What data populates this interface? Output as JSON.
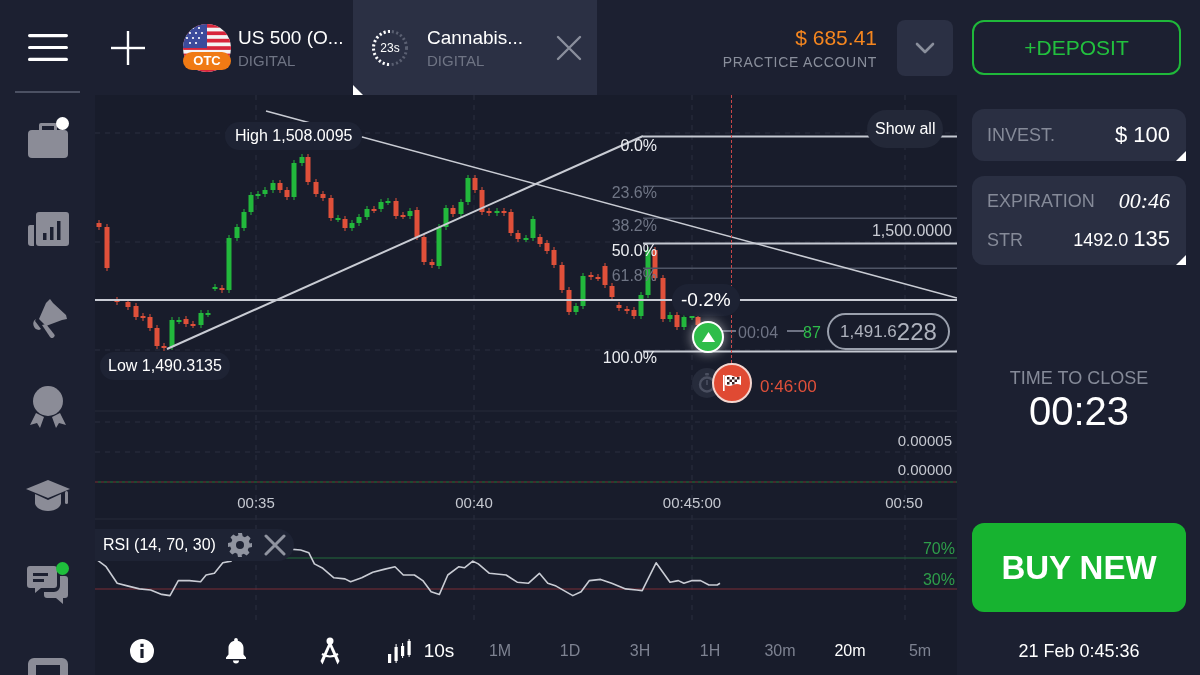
{
  "top_bar": {
    "assets": [
      {
        "kind": "flag",
        "name": "US 500 (O...",
        "type": "DIGITAL",
        "badge": "OTC",
        "selected": false
      },
      {
        "kind": "timer",
        "name": "Cannabis...",
        "type": "DIGITAL",
        "timer": "23s",
        "selected": true
      }
    ],
    "balance": "$ 685.41",
    "account": "PRACTICE ACCOUNT"
  },
  "sidebar": {
    "items": [
      {
        "notification": true,
        "color": "#ffffff"
      },
      {
        "notification": false
      },
      {
        "notification": false
      },
      {
        "notification": false
      },
      {
        "notification": false
      },
      {
        "notification": true,
        "color": "#1fbf3c"
      },
      {
        "notification": false
      }
    ]
  },
  "chart": {
    "high_label": "High 1,508.0095",
    "low_label": "Low 1,490.3135",
    "fib_levels": [
      {
        "label": "0.0%",
        "highlighted": true
      },
      {
        "label": "23.6%",
        "highlighted": false
      },
      {
        "label": "38.2%",
        "highlighted": false
      },
      {
        "label": "50.0%",
        "highlighted": true
      },
      {
        "label": "61.8%",
        "highlighted": false
      },
      {
        "label": "100.0%",
        "highlighted": true
      }
    ],
    "show_all": "Show all",
    "price_level": "1,500.0000",
    "change": "-0.2%",
    "trade": {
      "kind": "up",
      "countdown": "00:04",
      "payout": "87"
    },
    "current_price": {
      "main": "1,491.6",
      "tail": "228"
    },
    "expiry": "0:46:00",
    "scale_labels": [
      "0.00005",
      "0.00000"
    ],
    "time_axis": [
      "00:35",
      "00:40",
      "00:45:00",
      "00:50"
    ]
  },
  "rsi": {
    "label": "RSI (14, 70, 30)",
    "levels": [
      "70%",
      "30%"
    ]
  },
  "toolbar": {
    "interval": "10s",
    "periods": [
      {
        "label": "1M",
        "selected": false
      },
      {
        "label": "1D",
        "selected": false
      },
      {
        "label": "3H",
        "selected": false
      },
      {
        "label": "1H",
        "selected": false
      },
      {
        "label": "30m",
        "selected": false
      },
      {
        "label": "20m",
        "selected": true
      },
      {
        "label": "5m",
        "selected": false
      }
    ]
  },
  "trade_panel": {
    "deposit": "+DEPOSIT",
    "invest_label": "INVEST.",
    "invest_amount": "$ 100",
    "expiration_label": "EXPIRATION",
    "expiration_time": "00:46",
    "strike_label": "STR",
    "strike_price": "1492.0",
    "strike_tail": "135",
    "time_to_close_label": "TIME TO CLOSE",
    "time_to_close": "00:23",
    "buy": "BUY NEW",
    "datetime": "21 Feb 0:45:36"
  }
}
